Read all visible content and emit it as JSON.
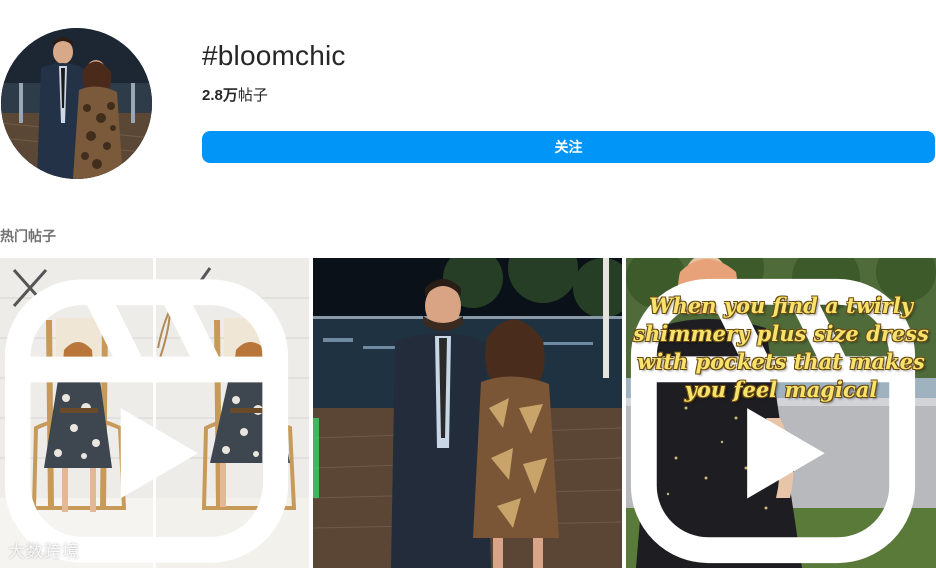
{
  "header": {
    "hashtag": "#bloomchic",
    "post_count_number": "2.8万",
    "post_count_suffix": "帖子",
    "follow_label": "关注"
  },
  "section": {
    "label": "热门帖子"
  },
  "posts": [
    {
      "kind": "image",
      "has_reel_badge": true,
      "watermark": "大数跨境"
    },
    {
      "kind": "image",
      "has_reel_badge": false
    },
    {
      "kind": "reel",
      "has_reel_badge": true,
      "caption": "When you find a twirly shimmery plus size dress with pockets that makes you feel magical"
    }
  ],
  "colors": {
    "primary": "#0095f6",
    "text": "#262626",
    "muted": "#737373",
    "caption_fill": "#f7e36b"
  }
}
